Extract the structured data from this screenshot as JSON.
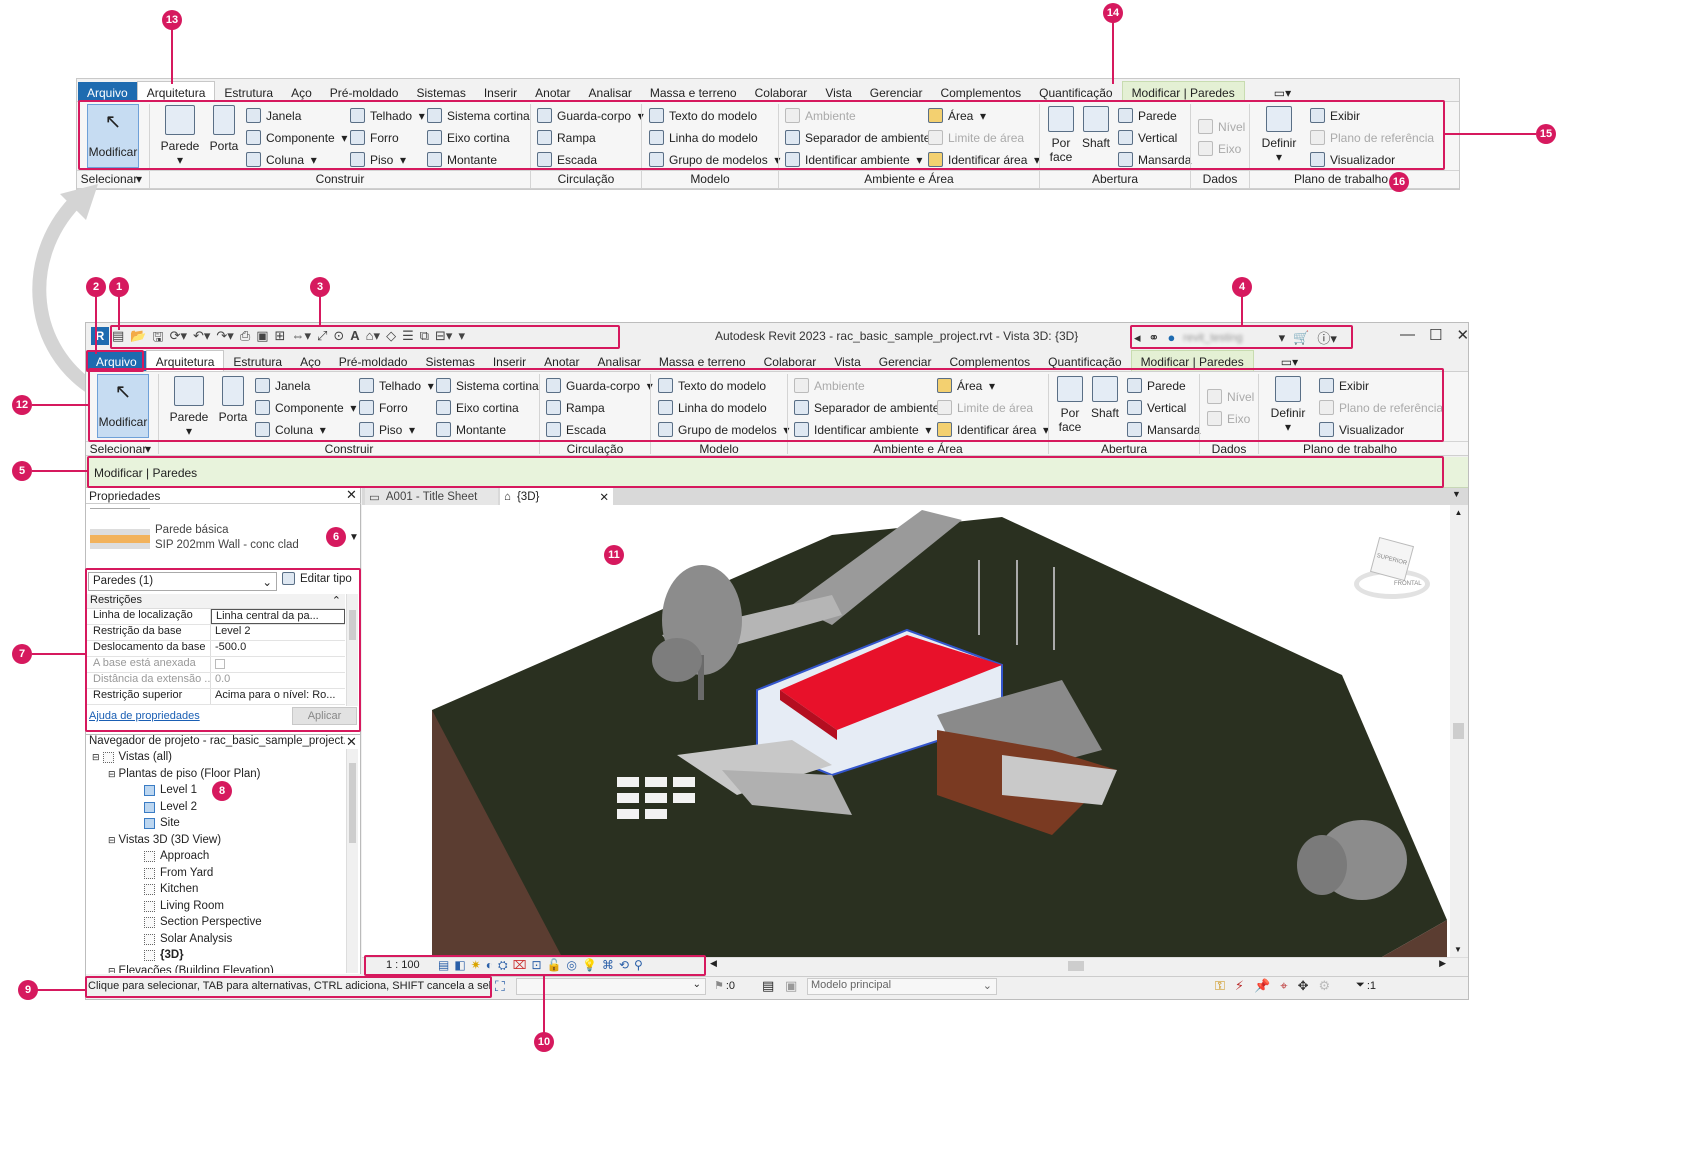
{
  "callouts": {
    "n1": "1",
    "n2": "2",
    "n3": "3",
    "n4": "4",
    "n5": "5",
    "n6": "6",
    "n7": "7",
    "n8": "8",
    "n9": "9",
    "n10": "10",
    "n11": "11",
    "n12": "12",
    "n13": "13",
    "n14": "14",
    "n15": "15",
    "n16": "16"
  },
  "colors": {
    "accent": "#d6195e",
    "file_tab": "#1e6bb0",
    "contextual_tab": "#e4f0d4",
    "options_bar": "#e8f3dc",
    "roof": "#e8112a",
    "terrain": "#2a3020"
  },
  "ribbon": {
    "tabs": [
      "Arquivo",
      "Arquitetura",
      "Estrutura",
      "Aço",
      "Pré-moldado",
      "Sistemas",
      "Inserir",
      "Anotar",
      "Analisar",
      "Massa e terreno",
      "Colaborar",
      "Vista",
      "Gerenciar",
      "Complementos",
      "Quantificação",
      "Modificar | Paredes"
    ],
    "select": {
      "modify": "Modificar",
      "panel": "Selecionar"
    },
    "build": {
      "wall": "Parede",
      "door": "Porta",
      "window": "Janela",
      "component": "Componente",
      "column": "Coluna",
      "roof": "Telhado",
      "ceiling": "Forro",
      "floor": "Piso",
      "curtain_system": "Sistema cortina",
      "curtain_grid": "Eixo cortina",
      "mullion": "Montante",
      "panel": "Construir"
    },
    "circulation": {
      "railing": "Guarda-corpo",
      "ramp": "Rampa",
      "stair": "Escada",
      "panel": "Circulação"
    },
    "model": {
      "text": "Texto do modelo",
      "line": "Linha do modelo",
      "group": "Grupo de modelos",
      "panel": "Modelo"
    },
    "room": {
      "room": "Ambiente",
      "separator": "Separador de ambiente",
      "tag_room": "Identificar ambiente",
      "area": "Área",
      "area_boundary": "Limite de área",
      "tag_area": "Identificar área",
      "panel": "Ambiente e Área"
    },
    "opening": {
      "by_face": "Por face",
      "shaft": "Shaft",
      "wall": "Parede",
      "vertical": "Vertical",
      "dormer": "Mansarda",
      "panel": "Abertura"
    },
    "datum": {
      "level": "Nível",
      "grid": "Eixo",
      "panel": "Dados"
    },
    "workplane": {
      "set": "Definir",
      "show": "Exibir",
      "ref_plane": "Plano de referência",
      "viewer": "Visualizador",
      "panel": "Plano de trabalho"
    }
  },
  "window": {
    "title": "Autodesk Revit 2023 - rac_basic_sample_project.rvt - Vista 3D: {3D}",
    "user": "revit_testing"
  },
  "options_bar": {
    "label": "Modificar | Paredes"
  },
  "properties": {
    "title": "Propriedades",
    "type_family": "Parede básica",
    "type_name": "SIP 202mm Wall - conc clad",
    "instance_filter": "Paredes (1)",
    "edit_type": "Editar tipo",
    "group": "Restrições",
    "rows": [
      {
        "k": "Linha de localização",
        "v": "Linha central da pa..."
      },
      {
        "k": "Restrição da base",
        "v": "Level 2"
      },
      {
        "k": "Deslocamento da base",
        "v": "-500.0"
      },
      {
        "k": "A base está anexada",
        "v": ""
      },
      {
        "k": "Distância da extensão ...",
        "v": "0.0"
      },
      {
        "k": "Restrição superior",
        "v": "Acima para o nível: Ro..."
      }
    ],
    "help": "Ajuda de propriedades",
    "apply": "Aplicar"
  },
  "browser": {
    "title": "Navegador de projeto - rac_basic_sample_project...",
    "views_all": "Vistas (all)",
    "floor_plans": "Plantas de piso (Floor Plan)",
    "fp_items": [
      "Level 1",
      "Level 2",
      "Site"
    ],
    "views_3d": "Vistas 3D (3D View)",
    "v3d_items": [
      "Approach",
      "From Yard",
      "Kitchen",
      "Living Room",
      "Section Perspective",
      "Solar Analysis",
      "{3D}"
    ],
    "elevations": "Elevações (Building Elevation)"
  },
  "doc_tabs": {
    "sheet": "A001 - Title Sheet",
    "view3d": "{3D}"
  },
  "view_control": {
    "scale": "1 : 100"
  },
  "status": {
    "hint": "Clique para selecionar, TAB para alternativas, CTRL adiciona, SHIFT cancela a seleção.",
    "worksets": ":0",
    "model": "Modelo principal",
    "filter": ":1"
  },
  "viewcube": {
    "top": "SUPERIOR",
    "front": "FRONTAL"
  }
}
